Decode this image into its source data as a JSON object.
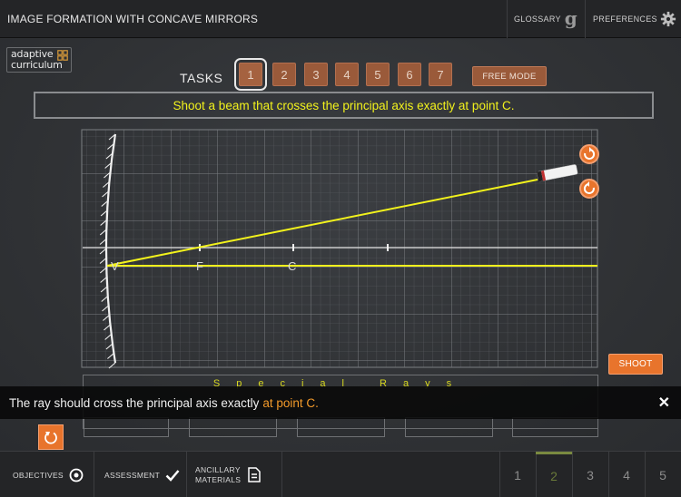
{
  "header": {
    "title": "IMAGE FORMATION WITH CONCAVE MIRRORS",
    "glossary_label": "GLOSSARY",
    "preferences_label": "PREFERENCES",
    "glossary_icon": "g"
  },
  "logo": {
    "line1": "adaptive",
    "line2": "curriculum"
  },
  "tasks": {
    "label": "TASKS",
    "items": [
      "1",
      "2",
      "3",
      "4",
      "5",
      "6",
      "7"
    ],
    "active_index": 0,
    "free_mode_label": "FREE MODE"
  },
  "instruction": "Shoot a beam that crosses the principal axis exactly at point C.",
  "simulation": {
    "point_labels": {
      "vertex": "V",
      "focus": "F",
      "center": "C"
    }
  },
  "shoot_label": "SHOOT",
  "special_rays_label": "Special Rays",
  "message": {
    "text": "The ray should cross the principal axis exactly",
    "highlight": "at point C.",
    "close_icon": "✕"
  },
  "bottom": {
    "objectives_label": "OBJECTIVES",
    "assessment_label": "ASSESSMENT",
    "ancillary_line1": "ANCILLARY",
    "ancillary_line2": "MATERIALS",
    "pages": [
      "1",
      "2",
      "3",
      "4",
      "5"
    ],
    "active_page_index": 1
  },
  "colors": {
    "accent": "#e8742c",
    "ray": "#f2f21c",
    "task_button": "#9a5a3a",
    "message_highlight": "#f39a2a"
  }
}
